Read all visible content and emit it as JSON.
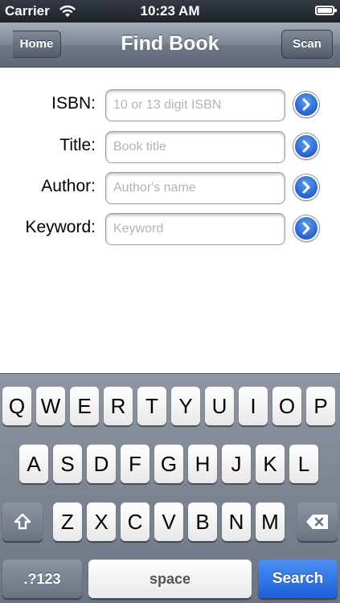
{
  "status_bar": {
    "carrier": "Carrier",
    "time": "10:23 AM",
    "wifi_icon": "wifi-icon",
    "battery_icon": "battery-icon"
  },
  "nav_bar": {
    "title": "Find Book",
    "back_label": "Home",
    "scan_label": "Scan"
  },
  "form": {
    "fields": [
      {
        "label": "ISBN:",
        "placeholder": "10 or 13 digit ISBN",
        "value": ""
      },
      {
        "label": "Title:",
        "placeholder": "Book title",
        "value": ""
      },
      {
        "label": "Author:",
        "placeholder": "Author's name",
        "value": ""
      },
      {
        "label": "Keyword:",
        "placeholder": "Keyword",
        "value": ""
      }
    ],
    "go_icon": "chevron-right-icon",
    "go_color": "#2e6cd1"
  },
  "keyboard": {
    "row1": [
      "Q",
      "W",
      "E",
      "R",
      "T",
      "Y",
      "U",
      "I",
      "O",
      "P"
    ],
    "row2": [
      "A",
      "S",
      "D",
      "F",
      "G",
      "H",
      "J",
      "K",
      "L"
    ],
    "row3": [
      "Z",
      "X",
      "C",
      "V",
      "B",
      "N",
      "M"
    ],
    "shift_icon": "shift-icon",
    "delete_icon": "backspace-icon",
    "numbers_label": ".?123",
    "space_label": "space",
    "search_label": "Search",
    "search_color": "#1d60d8"
  }
}
